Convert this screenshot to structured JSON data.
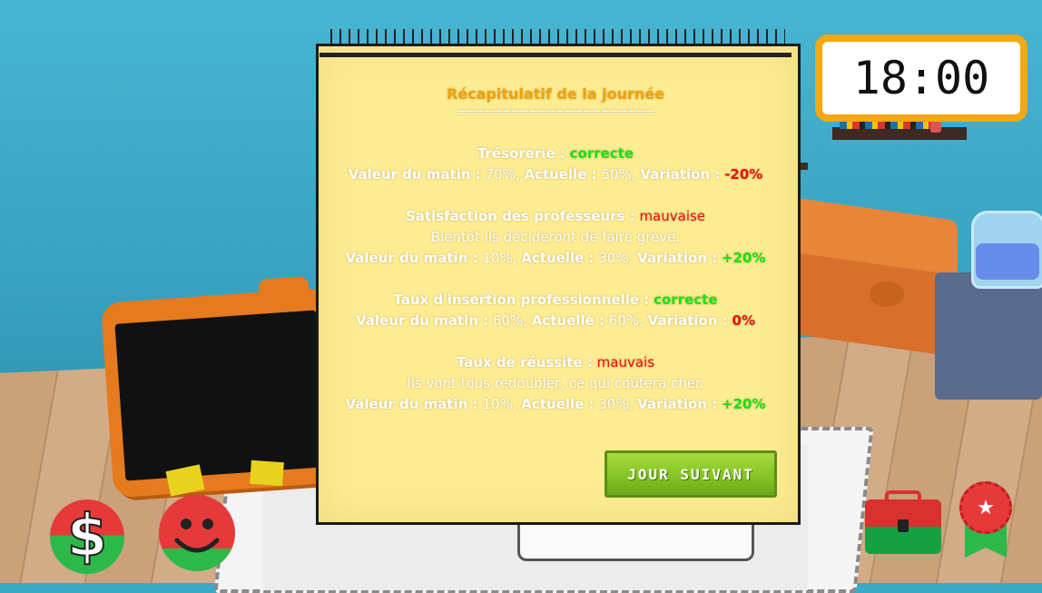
{
  "clock": {
    "time": "18:00"
  },
  "summary": {
    "title": "Récapitulatif de la journée",
    "separator": "======================",
    "labels": {
      "morning": "Valeur du matin :",
      "current": "Actuelle :",
      "variation": "Variation :"
    },
    "sections": [
      {
        "name": "Trésorerie :",
        "status": "correcte",
        "status_color": "#18e212",
        "comment": "",
        "morning": "70%,",
        "current": "50%,",
        "variation": "-20%",
        "variation_color": "#e81010"
      },
      {
        "name": "Satisfaction des professeurs :",
        "status": "mauvaise",
        "status_color": "#e81010",
        "comment": "Bientôt ils décideront de faire grève.",
        "morning": "10%,",
        "current": "30%,",
        "variation": "+20%",
        "variation_color": "#18e212"
      },
      {
        "name": "Taux d'insertion professionnelle :",
        "status": "correcte",
        "status_color": "#18e212",
        "comment": "",
        "morning": "60%,",
        "current": "60%,",
        "variation": "0%",
        "variation_color": "#e81010"
      },
      {
        "name": "Taux de réussite :",
        "status": "mauvais",
        "status_color": "#e81010",
        "comment": "Ils vont tous redoubler, ce qui coûtera cher.",
        "morning": "10%,",
        "current": "30%,",
        "variation": "+20%",
        "variation_color": "#18e212"
      }
    ],
    "next_button": "JOUR SUIVANT"
  },
  "toolbar": {
    "money_icon": "dollar-icon",
    "smile_icon": "smiley-icon",
    "case_icon": "briefcase-icon",
    "medal_icon": "medal-icon",
    "money_glyph": "$"
  },
  "colors": {
    "accent": "#f4a812",
    "good": "#18e212",
    "bad": "#e81010",
    "button": "#86c426"
  }
}
